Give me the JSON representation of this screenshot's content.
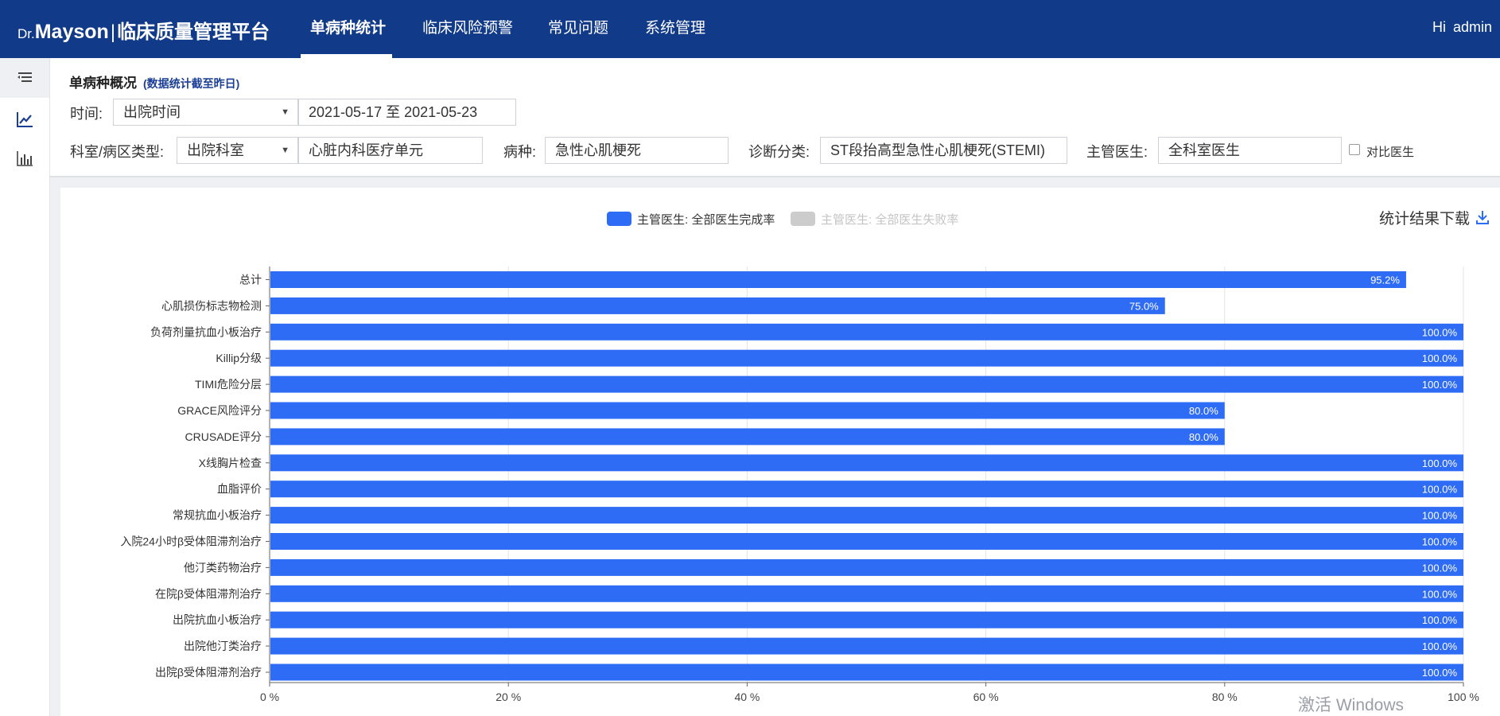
{
  "header": {
    "brand_dr": "Dr.",
    "brand_name": "Mayson",
    "brand_sep": "|",
    "brand_platform": "临床质量管理平台",
    "tabs": [
      {
        "label": "单病种统计"
      },
      {
        "label": "临床风险预警"
      },
      {
        "label": "常见问题"
      },
      {
        "label": "系统管理"
      }
    ],
    "greeting": "Hi",
    "user": "admin"
  },
  "sidebar": {
    "icons": [
      "menu-icon",
      "line-chart-icon",
      "bar-chart-icon"
    ]
  },
  "filters": {
    "section_title": "单病种概况",
    "section_note": "(数据统计截至昨日)",
    "time_label": "时间:",
    "time_type": "出院时间",
    "date_range": "2021-05-17 至 2021-05-23",
    "dept_type_label": "科室/病区类型:",
    "dept_type": "出院科室",
    "dept_value": "心脏内科医疗单元",
    "disease_label": "病种:",
    "disease_value": "急性心肌梗死",
    "diag_label": "诊断分类:",
    "diag_value": "ST段抬高型急性心肌梗死(STEMI)",
    "doctor_label": "主管医生:",
    "doctor_value": "全科室医生",
    "compare_label": "对比医生",
    "compare_checked": false
  },
  "chart_section": {
    "download_label": "统计结果下载",
    "watermark": "激活 Windows"
  },
  "chart_data": {
    "type": "bar",
    "orientation": "horizontal",
    "categories": [
      "总计",
      "心肌损伤标志物检测",
      "负荷剂量抗血小板治疗",
      "Killip分级",
      "TIMI危险分层",
      "GRACE风险评分",
      "CRUSADE评分",
      "X线胸片检查",
      "血脂评价",
      "常规抗血小板治疗",
      "入院24小时β受体阻滞剂治疗",
      "他汀类药物治疗",
      "在院β受体阻滞剂治疗",
      "出院抗血小板治疗",
      "出院他汀类治疗",
      "出院β受体阻滞剂治疗"
    ],
    "series": [
      {
        "name": "主管医生: 全部医生完成率",
        "color": "#2f6cf6",
        "values": [
          95.2,
          75.0,
          100.0,
          100.0,
          100.0,
          80.0,
          80.0,
          100.0,
          100.0,
          100.0,
          100.0,
          100.0,
          100.0,
          100.0,
          100.0,
          100.0
        ]
      },
      {
        "name": "主管医生: 全部医生失败率",
        "color": "#cccccc",
        "hidden": true,
        "values": []
      }
    ],
    "data_labels": [
      "95.2%",
      "75.0%",
      "100.0%",
      "100.0%",
      "100.0%",
      "80.0%",
      "80.0%",
      "100.0%",
      "100.0%",
      "100.0%",
      "100.0%",
      "100.0%",
      "100.0%",
      "100.0%",
      "100.0%",
      "100.0%"
    ],
    "x_ticks": [
      "0 %",
      "20 %",
      "40 %",
      "60 %",
      "80 %",
      "100 %"
    ],
    "xlim": [
      0,
      100
    ],
    "grid": true,
    "legend_position": "top-center"
  }
}
